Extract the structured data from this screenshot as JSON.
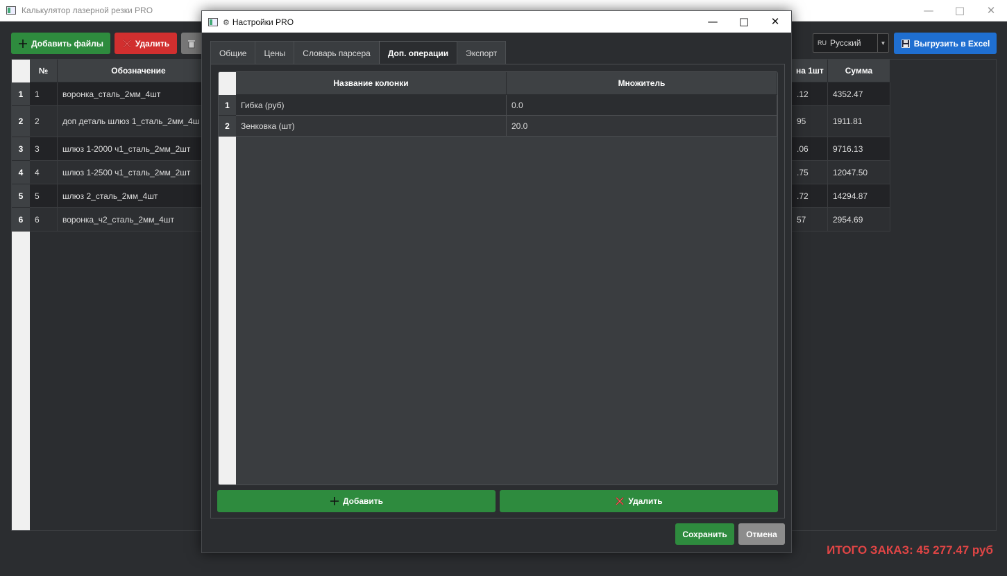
{
  "main_window": {
    "title": "Калькулятор лазерной резки PRO",
    "toolbar": {
      "add_files_label": "Добавить файлы",
      "delete_label": "Удалить",
      "language": {
        "flag": "RU",
        "selected": "Русский"
      },
      "export_excel_label": "Выгрузить в Excel"
    },
    "table": {
      "headers": {
        "num": "№",
        "designation": "Обозначение",
        "price_per_unit": "на 1шт",
        "sum": "Сумма"
      },
      "rows": [
        {
          "row": "1",
          "num": "1",
          "designation": "воронка_сталь_2мм_4шт",
          "price_per_unit": ".12",
          "sum": "4352.47"
        },
        {
          "row": "2",
          "num": "2",
          "designation": "доп деталь шлюз 1_сталь_2мм_4ш",
          "price_per_unit": "95",
          "sum": "1911.81"
        },
        {
          "row": "3",
          "num": "3",
          "designation": "шлюз 1-2000 ч1_сталь_2мм_2шт",
          "price_per_unit": ".06",
          "sum": "9716.13"
        },
        {
          "row": "4",
          "num": "4",
          "designation": "шлюз 1-2500 ч1_сталь_2мм_2шт",
          "price_per_unit": ".75",
          "sum": "12047.50"
        },
        {
          "row": "5",
          "num": "5",
          "designation": "шлюз 2_сталь_2мм_4шт",
          "price_per_unit": ".72",
          "sum": "14294.87"
        },
        {
          "row": "6",
          "num": "6",
          "designation": "воронка_ч2_сталь_2мм_4шт",
          "price_per_unit": "57",
          "sum": "2954.69"
        }
      ]
    },
    "order_total": "ИТОГО ЗАКАЗ: 45 277.47 руб"
  },
  "dialog": {
    "title": "Настройки PRO",
    "tabs": [
      {
        "label": "Общие",
        "active": false
      },
      {
        "label": "Цены",
        "active": false
      },
      {
        "label": "Словарь парсера",
        "active": false
      },
      {
        "label": "Доп. операции",
        "active": true
      },
      {
        "label": "Экспорт",
        "active": false
      }
    ],
    "ops_table": {
      "headers": {
        "column_name": "Название колонки",
        "multiplier": "Множитель"
      },
      "rows": [
        {
          "row": "1",
          "column_name": "Гибка (руб)",
          "multiplier": "0.0"
        },
        {
          "row": "2",
          "column_name": "Зенковка (шт)",
          "multiplier": "20.0"
        }
      ]
    },
    "add_label": "Добавить",
    "delete_label": "Удалить",
    "save_label": "Сохранить",
    "cancel_label": "Отмена"
  },
  "colors": {
    "green": "#2e8b3e",
    "red": "#d12f2f",
    "blue": "#1f6fd1",
    "total_red": "#e04545",
    "dark_bg": "#2b2d30"
  }
}
